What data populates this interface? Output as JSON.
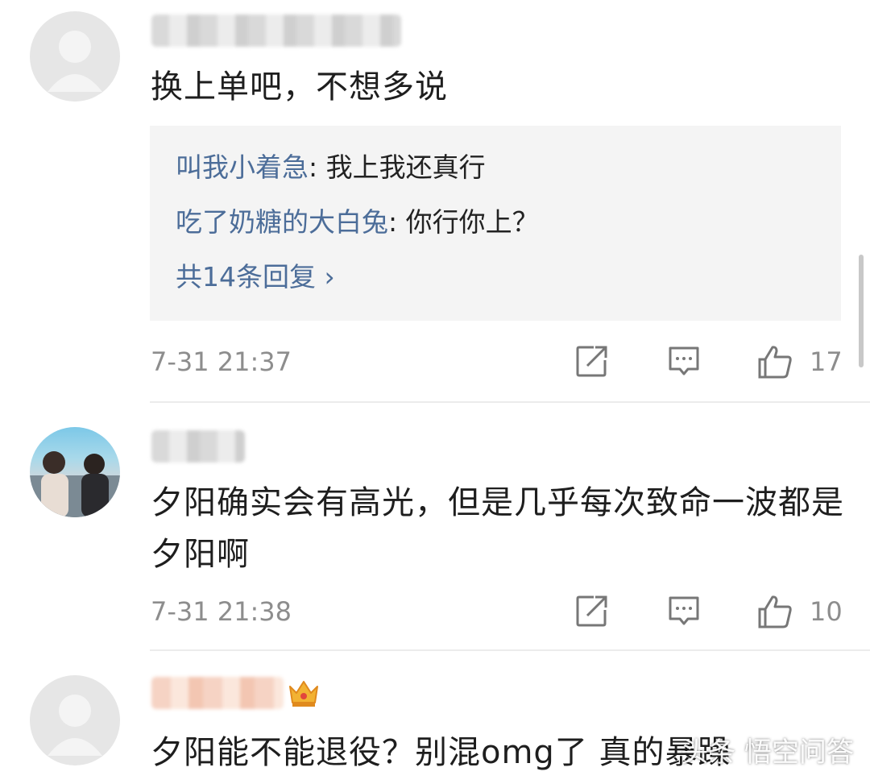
{
  "comments": [
    {
      "text": "换上单吧，不想多说",
      "replies": [
        {
          "user": "叫我小着急",
          "sep": ": ",
          "text": "我上我还真行"
        },
        {
          "user": "吃了奶糖的大白兔",
          "sep": ": ",
          "text": "你行你上？"
        }
      ],
      "more_replies": "共14条回复 ›",
      "time": "7-31 21:37",
      "likes": "17"
    },
    {
      "text": "夕阳确实会有高光，但是几乎每次致命一波都是夕阳啊",
      "time": "7-31 21:38",
      "likes": "10"
    },
    {
      "text": "夕阳能不能退役？别混omg了 真的暴躁"
    }
  ],
  "watermark": "头条 悟空问答",
  "icons": {
    "share": "share-icon",
    "reply": "comment-icon",
    "like": "thumbs-up-icon",
    "badge": "crown-badge-icon"
  },
  "colors": {
    "username_link": "#4c6d99",
    "meta_gray": "#8d8d8d",
    "reply_bg": "#f4f4f4"
  }
}
